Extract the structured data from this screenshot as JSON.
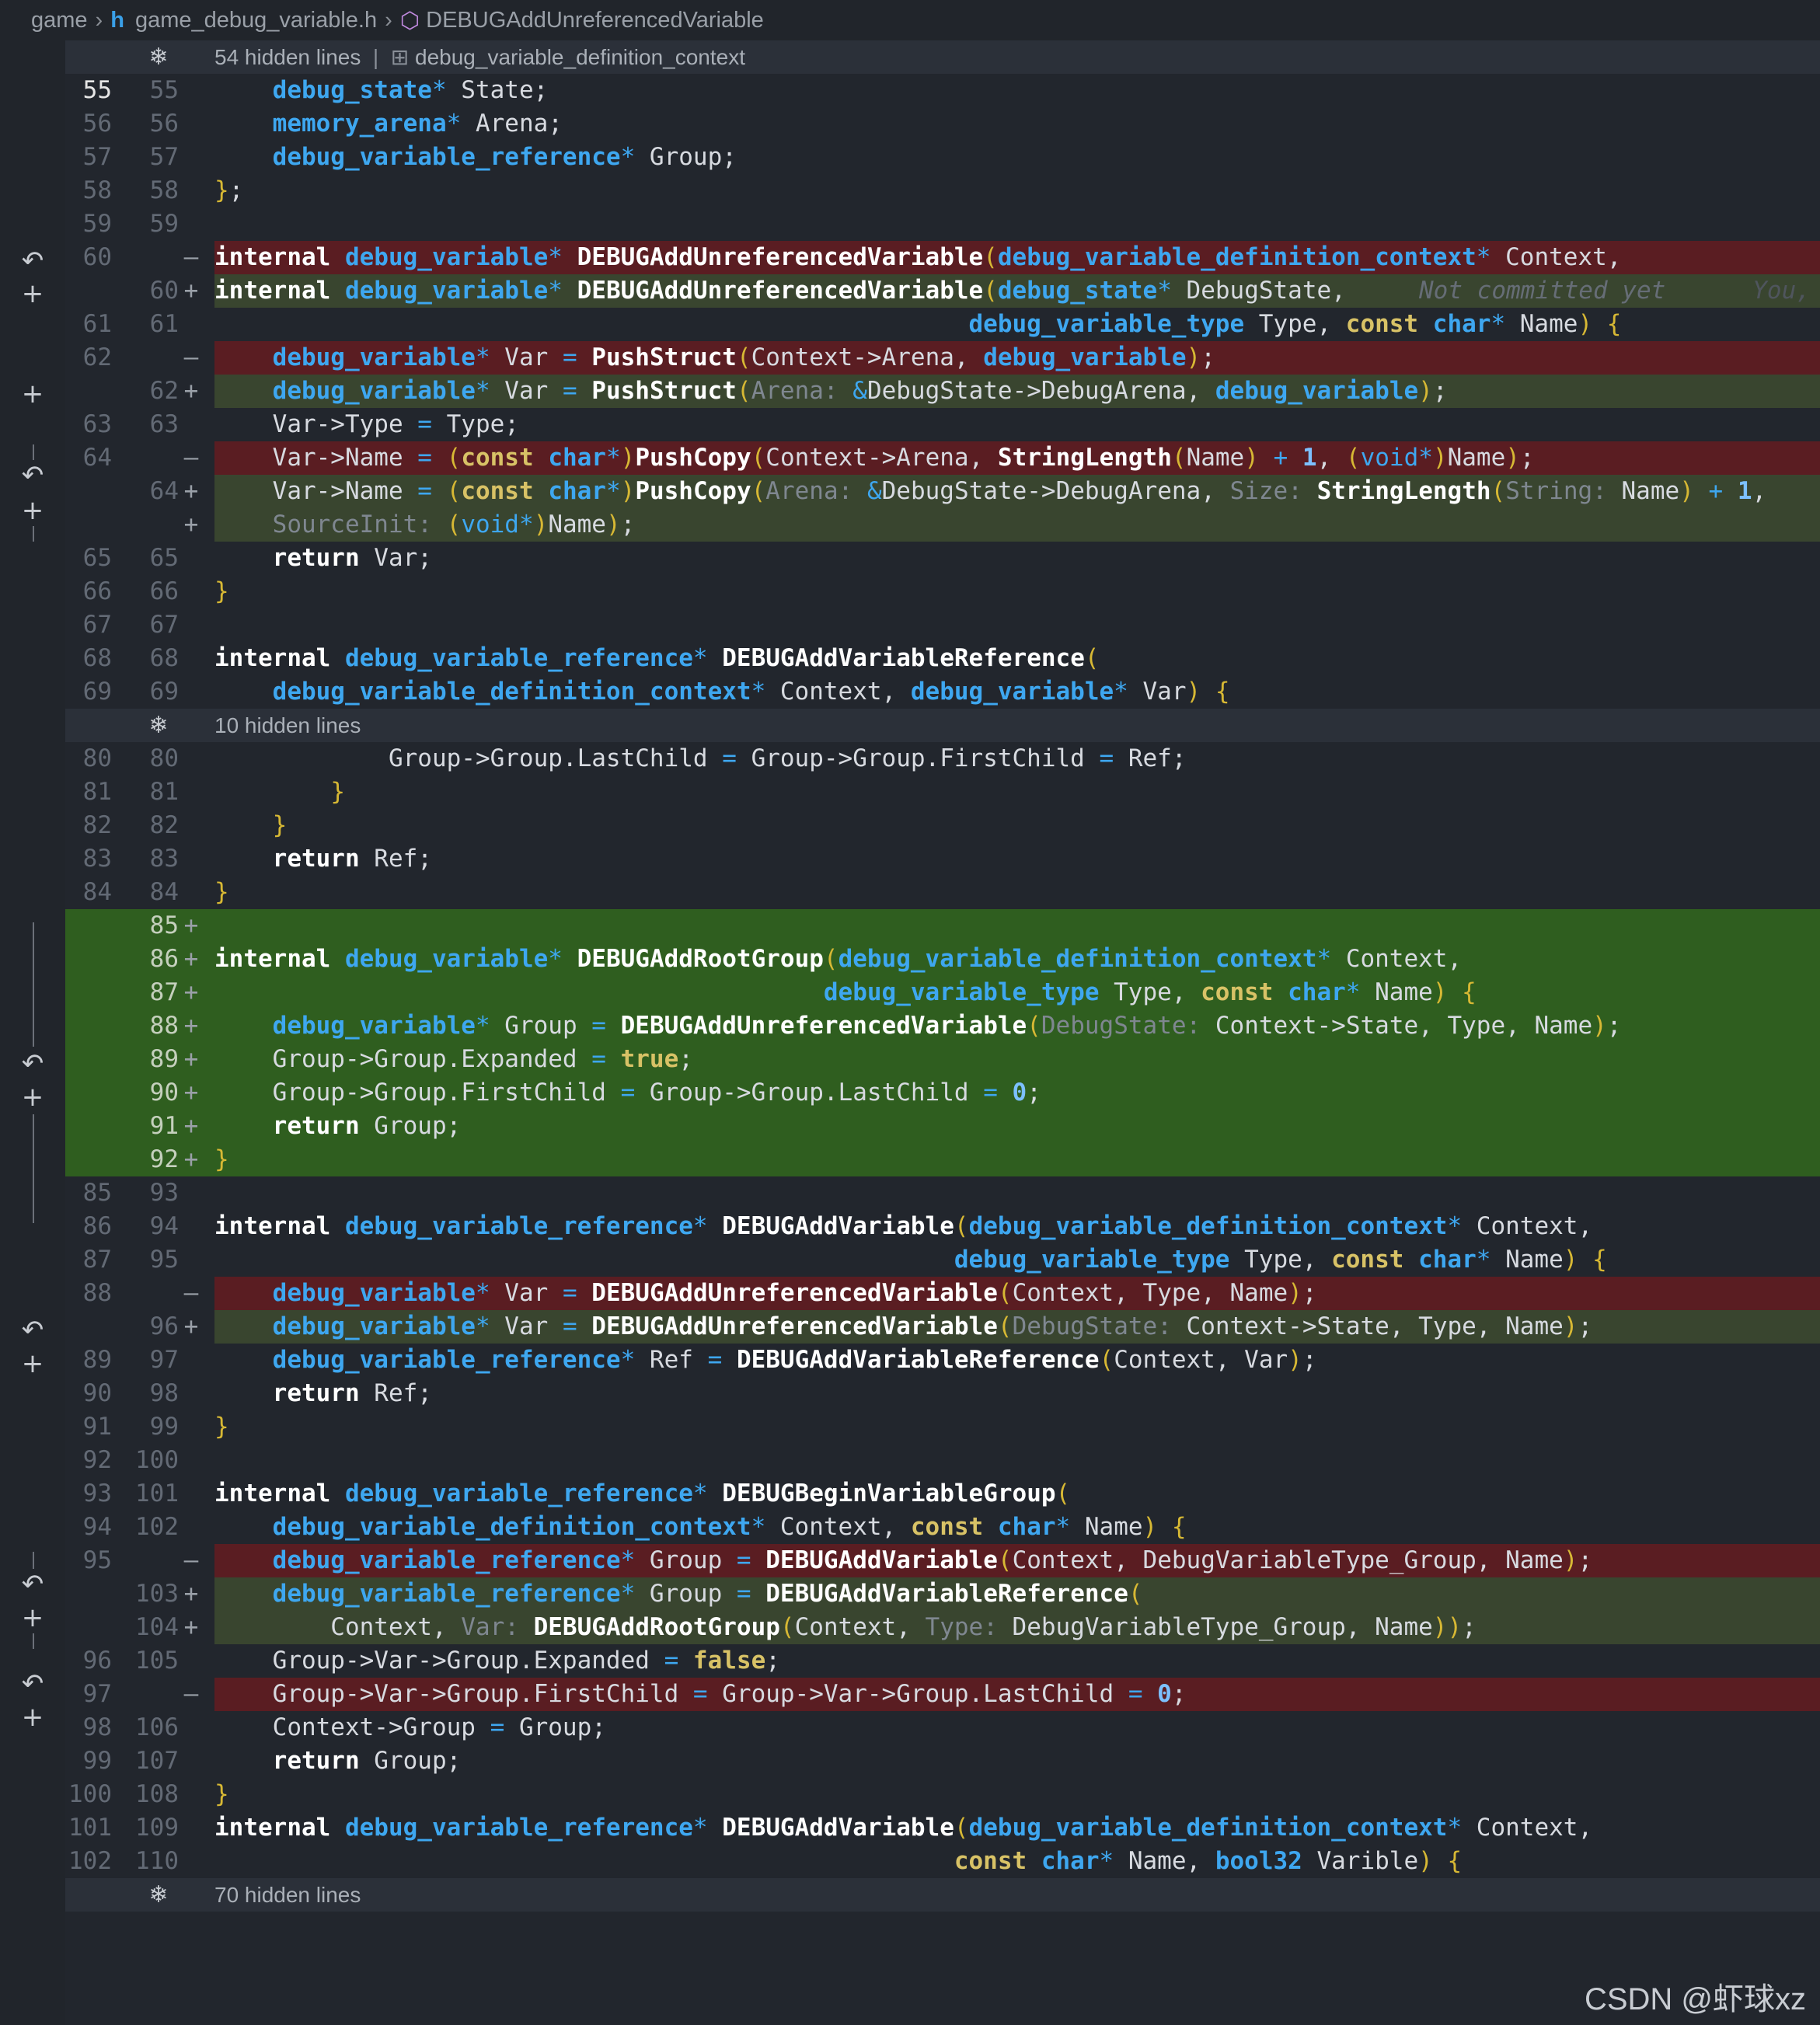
{
  "breadcrumb": {
    "folder": "game",
    "file": "game_debug_variable.h",
    "symbol": "DEBUGAddUnreferencedVariable"
  },
  "hidden_blocks": [
    {
      "label": "54 hidden lines",
      "context": "debug_variable_definition_context"
    },
    {
      "label": "10 hidden lines"
    },
    {
      "label": "70 hidden lines"
    }
  ],
  "blame": {
    "text": "Not committed yet",
    "author": "You,"
  },
  "rows": [
    {
      "o": "55",
      "n": "55",
      "m": "",
      "t": "    debug_state* State;"
    },
    {
      "o": "56",
      "n": "56",
      "m": "",
      "t": "    memory_arena* Arena;"
    },
    {
      "o": "57",
      "n": "57",
      "m": "",
      "t": "    debug_variable_reference* Group;"
    },
    {
      "o": "58",
      "n": "58",
      "m": "",
      "t": "};"
    },
    {
      "o": "59",
      "n": "59",
      "m": "",
      "t": ""
    },
    {
      "o": "60",
      "n": "",
      "m": "—",
      "t": "internal debug_variable* DEBUGAddUnreferencedVariable(debug_variable_definition_context* Context,"
    },
    {
      "o": "",
      "n": "60",
      "m": "+",
      "t": "internal debug_variable* DEBUGAddUnreferencedVariable(debug_state* DebugState,"
    },
    {
      "o": "61",
      "n": "61",
      "m": "",
      "t": "                                                    debug_variable_type Type, const char* Name) {"
    },
    {
      "o": "62",
      "n": "",
      "m": "—",
      "t": "    debug_variable* Var = PushStruct(Context->Arena, debug_variable);"
    },
    {
      "o": "",
      "n": "62",
      "m": "+",
      "t": "    debug_variable* Var = PushStruct(Arena: &DebugState->DebugArena, debug_variable);"
    },
    {
      "o": "63",
      "n": "63",
      "m": "",
      "t": "    Var->Type = Type;"
    },
    {
      "o": "64",
      "n": "",
      "m": "—",
      "t": "    Var->Name = (const char*)PushCopy(Context->Arena, StringLength(Name) + 1, (void*)Name);"
    },
    {
      "o": "",
      "n": "64",
      "m": "+",
      "t": "    Var->Name = (const char*)PushCopy(Arena: &DebugState->DebugArena, Size: StringLength(String: Name) + 1,"
    },
    {
      "o": "",
      "n": "",
      "m": "+",
      "t": "    SourceInit: (void*)Name);"
    },
    {
      "o": "65",
      "n": "65",
      "m": "",
      "t": "    return Var;"
    },
    {
      "o": "66",
      "n": "66",
      "m": "",
      "t": "}"
    },
    {
      "o": "67",
      "n": "67",
      "m": "",
      "t": ""
    },
    {
      "o": "68",
      "n": "68",
      "m": "",
      "t": "internal debug_variable_reference* DEBUGAddVariableReference("
    },
    {
      "o": "69",
      "n": "69",
      "m": "",
      "t": "    debug_variable_definition_context* Context, debug_variable* Var) {"
    },
    {
      "o": "80",
      "n": "80",
      "m": "",
      "t": "            Group->Group.LastChild = Group->Group.FirstChild = Ref;"
    },
    {
      "o": "81",
      "n": "81",
      "m": "",
      "t": "        }"
    },
    {
      "o": "82",
      "n": "82",
      "m": "",
      "t": "    }"
    },
    {
      "o": "83",
      "n": "83",
      "m": "",
      "t": "    return Ref;"
    },
    {
      "o": "84",
      "n": "84",
      "m": "",
      "t": "}"
    },
    {
      "o": "",
      "n": "85",
      "m": "+",
      "t": ""
    },
    {
      "o": "",
      "n": "86",
      "m": "+",
      "t": "internal debug_variable* DEBUGAddRootGroup(debug_variable_definition_context* Context,"
    },
    {
      "o": "",
      "n": "87",
      "m": "+",
      "t": "                                          debug_variable_type Type, const char* Name) {"
    },
    {
      "o": "",
      "n": "88",
      "m": "+",
      "t": "    debug_variable* Group = DEBUGAddUnreferencedVariable(DebugState: Context->State, Type, Name);"
    },
    {
      "o": "",
      "n": "89",
      "m": "+",
      "t": "    Group->Group.Expanded = true;"
    },
    {
      "o": "",
      "n": "90",
      "m": "+",
      "t": "    Group->Group.FirstChild = Group->Group.LastChild = 0;"
    },
    {
      "o": "",
      "n": "91",
      "m": "+",
      "t": "    return Group;"
    },
    {
      "o": "",
      "n": "92",
      "m": "+",
      "t": "}"
    },
    {
      "o": "85",
      "n": "93",
      "m": "",
      "t": ""
    },
    {
      "o": "86",
      "n": "94",
      "m": "",
      "t": "internal debug_variable_reference* DEBUGAddVariable(debug_variable_definition_context* Context,"
    },
    {
      "o": "87",
      "n": "95",
      "m": "",
      "t": "                                                   debug_variable_type Type, const char* Name) {"
    },
    {
      "o": "88",
      "n": "",
      "m": "—",
      "t": "    debug_variable* Var = DEBUGAddUnreferencedVariable(Context, Type, Name);"
    },
    {
      "o": "",
      "n": "96",
      "m": "+",
      "t": "    debug_variable* Var = DEBUGAddUnreferencedVariable(DebugState: Context->State, Type, Name);"
    },
    {
      "o": "89",
      "n": "97",
      "m": "",
      "t": "    debug_variable_reference* Ref = DEBUGAddVariableReference(Context, Var);"
    },
    {
      "o": "90",
      "n": "98",
      "m": "",
      "t": "    return Ref;"
    },
    {
      "o": "91",
      "n": "99",
      "m": "",
      "t": "}"
    },
    {
      "o": "92",
      "n": "100",
      "m": "",
      "t": ""
    },
    {
      "o": "93",
      "n": "101",
      "m": "",
      "t": "internal debug_variable_reference* DEBUGBeginVariableGroup("
    },
    {
      "o": "94",
      "n": "102",
      "m": "",
      "t": "    debug_variable_definition_context* Context, const char* Name) {"
    },
    {
      "o": "95",
      "n": "",
      "m": "—",
      "t": "    debug_variable_reference* Group = DEBUGAddVariable(Context, DebugVariableType_Group, Name);"
    },
    {
      "o": "",
      "n": "103",
      "m": "+",
      "t": "    debug_variable_reference* Group = DEBUGAddVariableReference("
    },
    {
      "o": "",
      "n": "104",
      "m": "+",
      "t": "        Context, Var: DEBUGAddRootGroup(Context, Type: DebugVariableType_Group, Name));"
    },
    {
      "o": "96",
      "n": "105",
      "m": "",
      "t": "    Group->Var->Group.Expanded = false;"
    },
    {
      "o": "97",
      "n": "",
      "m": "—",
      "t": "    Group->Var->Group.FirstChild = Group->Var->Group.LastChild = 0;"
    },
    {
      "o": "98",
      "n": "106",
      "m": "",
      "t": "    Context->Group = Group;"
    },
    {
      "o": "99",
      "n": "107",
      "m": "",
      "t": "    return Group;"
    },
    {
      "o": "100",
      "n": "108",
      "m": "",
      "t": "}"
    },
    {
      "o": "101",
      "n": "109",
      "m": "",
      "t": "internal debug_variable_reference* DEBUGAddVariable(debug_variable_definition_context* Context,"
    },
    {
      "o": "102",
      "n": "110",
      "m": "",
      "t": "                                                   const char* Name, bool32 Varible) {"
    }
  ],
  "watermark": "CSDN @虾球xz",
  "colors": {
    "deleted": "#5a1d22",
    "added": "#39452f",
    "added_block": "#2f5e1f",
    "type": "#3ea7f0"
  }
}
